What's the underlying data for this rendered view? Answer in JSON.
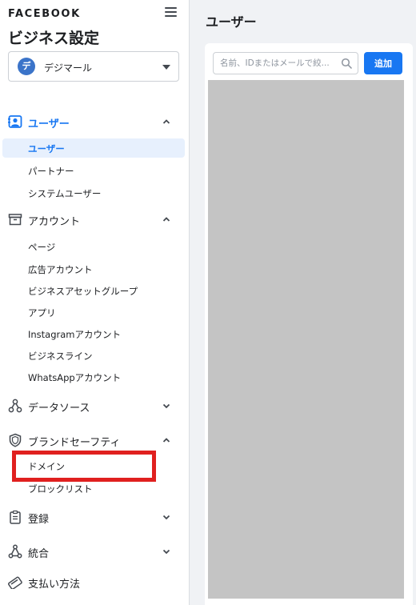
{
  "sidebar": {
    "brand": "FACEBOOK",
    "title": "ビジネス設定",
    "account": {
      "avatar_letter": "デ",
      "name": "デジマール"
    },
    "sections": [
      {
        "label": "ユーザー",
        "icon": "user-badge-icon",
        "expanded": true,
        "active": true,
        "items": [
          {
            "label": "ユーザー",
            "selected": true
          },
          {
            "label": "パートナー"
          },
          {
            "label": "システムユーザー"
          }
        ]
      },
      {
        "label": "アカウント",
        "icon": "archive-icon",
        "expanded": true,
        "items": [
          {
            "label": "ページ"
          },
          {
            "label": "広告アカウント"
          },
          {
            "label": "ビジネスアセットグループ"
          },
          {
            "label": "アプリ"
          },
          {
            "label": "Instagramアカウント"
          },
          {
            "label": "ビジネスライン"
          },
          {
            "label": "WhatsAppアカウント"
          }
        ]
      },
      {
        "label": "データソース",
        "icon": "data-sources-icon",
        "expanded": false
      },
      {
        "label": "ブランドセーフティ",
        "icon": "shield-icon",
        "expanded": true,
        "items": [
          {
            "label": "ドメイン",
            "highlighted": true
          },
          {
            "label": "ブロックリスト"
          }
        ]
      },
      {
        "label": "登録",
        "icon": "clipboard-icon",
        "expanded": false
      },
      {
        "label": "統合",
        "icon": "integrations-icon",
        "expanded": false
      },
      {
        "label": "支払い方法",
        "icon": "credit-card-icon",
        "expanded": false
      }
    ]
  },
  "main": {
    "title": "ユーザー",
    "search": {
      "placeholder": "名前、IDまたはメールで絞...",
      "value": ""
    },
    "add_label": "追加"
  },
  "colors": {
    "accent": "#1877f2",
    "highlight": "#e0201f",
    "selected_bg": "#e7f0fd",
    "panel_grey": "#c4c4c4"
  }
}
